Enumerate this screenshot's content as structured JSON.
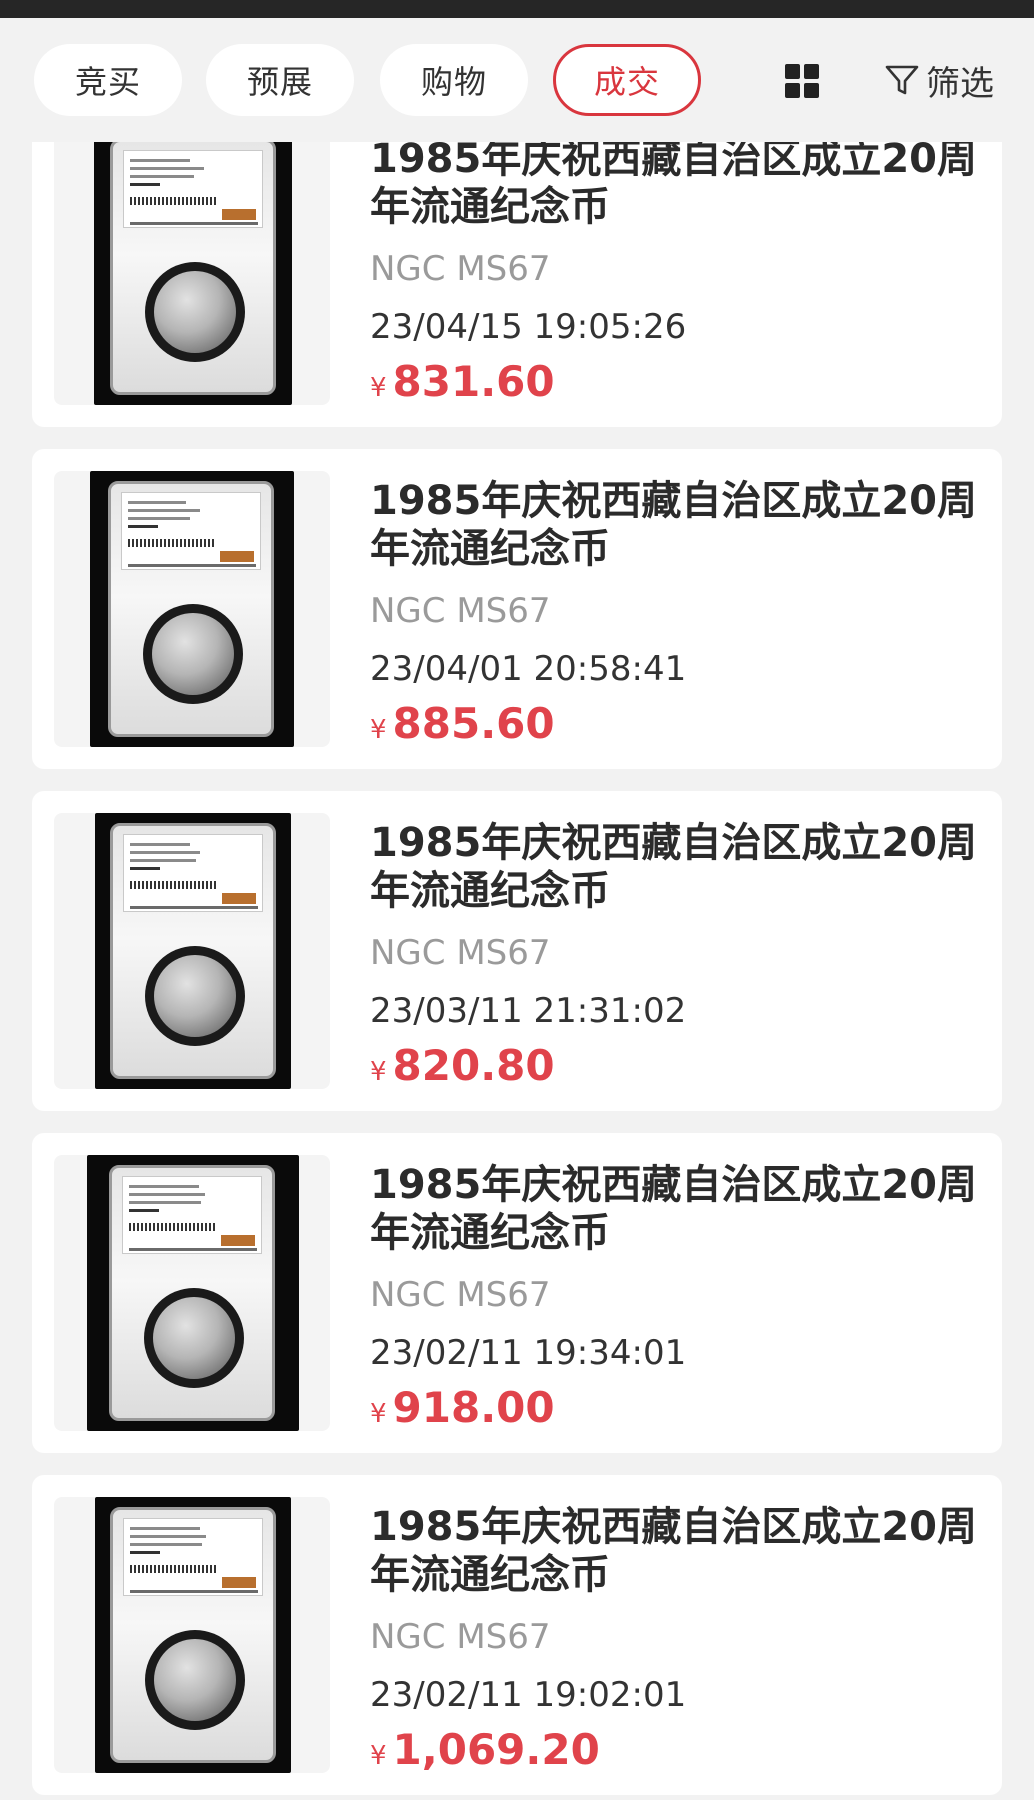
{
  "tabs": [
    {
      "label": "竞买",
      "active": false
    },
    {
      "label": "预展",
      "active": false
    },
    {
      "label": "购物",
      "active": false
    },
    {
      "label": "成交",
      "active": true
    }
  ],
  "toolbar": {
    "grid_icon": "grid-view-icon",
    "filter_icon": "funnel-icon",
    "filter_label": "筛选"
  },
  "colors": {
    "accent": "#d9363e",
    "price": "#e0434b",
    "background": "#f2f2f2",
    "card": "#ffffff"
  },
  "items": [
    {
      "title": "1985年庆祝西藏自治区成立20周年流通纪念币",
      "grade": "NGC MS67",
      "date": "23/04/15 19:05:26",
      "currency": "¥",
      "price": "831.60"
    },
    {
      "title": "1985年庆祝西藏自治区成立20周年流通纪念币",
      "grade": "NGC MS67",
      "date": "23/04/01 20:58:41",
      "currency": "¥",
      "price": "885.60"
    },
    {
      "title": "1985年庆祝西藏自治区成立20周年流通纪念币",
      "grade": "NGC MS67",
      "date": "23/03/11 21:31:02",
      "currency": "¥",
      "price": "820.80"
    },
    {
      "title": "1985年庆祝西藏自治区成立20周年流通纪念币",
      "grade": "NGC MS67",
      "date": "23/02/11 19:34:01",
      "currency": "¥",
      "price": "918.00"
    },
    {
      "title": "1985年庆祝西藏自治区成立20周年流通纪念币",
      "grade": "NGC MS67",
      "date": "23/02/11 19:02:01",
      "currency": "¥",
      "price": "1,069.20"
    }
  ]
}
